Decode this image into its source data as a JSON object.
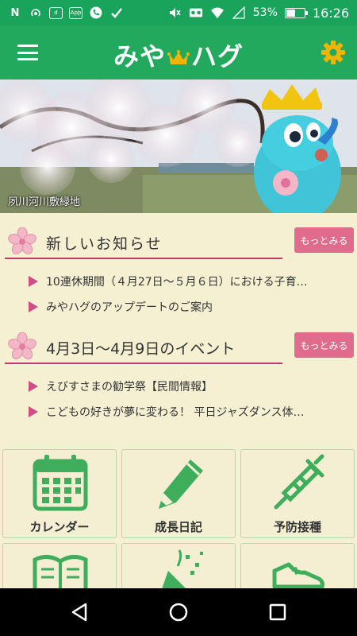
{
  "status_bar": {
    "left_icons": [
      "n-icon",
      "hotspot-icon",
      "d-icon",
      "app-icon",
      "phone-icon",
      "check-icon"
    ],
    "battery_percent": "53%",
    "battery_level": 0.53,
    "time": "16:26",
    "app_badge": "App"
  },
  "app_bar": {
    "title_left": "みや",
    "title_right": "ハグ",
    "colors": {
      "primary": "#22a95d",
      "accent": "#e06b8c",
      "crown": "#f0b400"
    }
  },
  "hero": {
    "caption": "夙川河川敷緑地"
  },
  "news": {
    "heading": "新しいお知らせ",
    "more_label": "もっとみる",
    "items": [
      "10連休期間（４月27日～５月６日）における子育…",
      "みやハグのアップデートのご案内"
    ]
  },
  "events": {
    "heading": "4月3日～4月9日のイベント",
    "more_label": "もっとみる",
    "items": [
      "えびすさまの勧学祭【民間情報】",
      "こどもの好きが夢に変わる！ 平日ジャズダンス体…"
    ]
  },
  "menu": {
    "tiles": [
      {
        "label": "カレンダー",
        "icon": "calendar-icon"
      },
      {
        "label": "成長日記",
        "icon": "pencil-icon"
      },
      {
        "label": "予防接種",
        "icon": "syringe-icon"
      },
      {
        "label": "",
        "icon": "book-icon"
      },
      {
        "label": "",
        "icon": "party-popper-icon"
      },
      {
        "label": "",
        "icon": "shoe-icon"
      }
    ]
  }
}
